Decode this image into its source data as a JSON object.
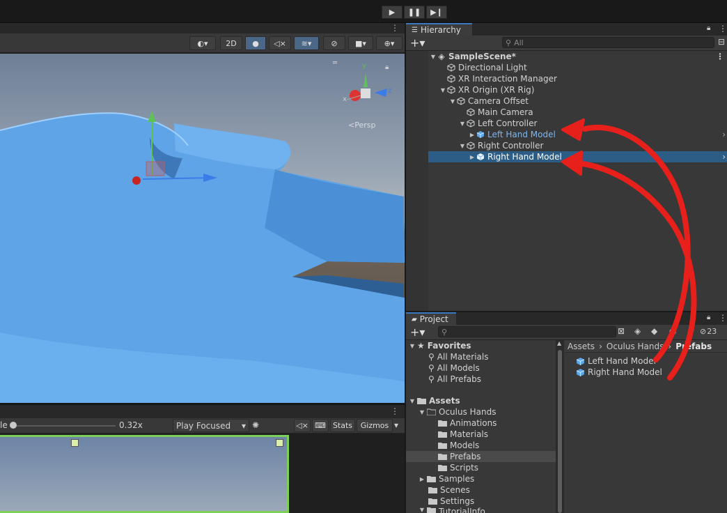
{
  "scene_toolbar": {
    "mode_2d": "2D"
  },
  "scene_view": {
    "axis_y": "y",
    "axis_z": "z",
    "axis_x": "x",
    "projection": "<Persp"
  },
  "game_toolbar": {
    "scale_label": "le",
    "scale_value": "0.32x",
    "play_mode": "Play Focused",
    "stats": "Stats",
    "gizmos": "Gizmos"
  },
  "hierarchy": {
    "tab_title": "Hierarchy",
    "search_placeholder": "All",
    "items": [
      {
        "label": "SampleScene*"
      },
      {
        "label": "Directional Light"
      },
      {
        "label": "XR Interaction Manager"
      },
      {
        "label": "XR Origin (XR Rig)"
      },
      {
        "label": "Camera Offset"
      },
      {
        "label": "Main Camera"
      },
      {
        "label": "Left Controller"
      },
      {
        "label": "Left Hand Model"
      },
      {
        "label": "Right Controller"
      },
      {
        "label": "Right Hand Model"
      }
    ]
  },
  "project": {
    "tab_title": "Project",
    "hidden_count": "23",
    "tree": [
      {
        "label": "Favorites"
      },
      {
        "label": "All Materials"
      },
      {
        "label": "All Models"
      },
      {
        "label": "All Prefabs"
      },
      {
        "label": "Assets"
      },
      {
        "label": "Oculus Hands"
      },
      {
        "label": "Animations"
      },
      {
        "label": "Materials"
      },
      {
        "label": "Models"
      },
      {
        "label": "Prefabs"
      },
      {
        "label": "Scripts"
      },
      {
        "label": "Samples"
      },
      {
        "label": "Scenes"
      },
      {
        "label": "Settings"
      },
      {
        "label": "TutorialInfo"
      }
    ],
    "breadcrumb": [
      "Assets",
      "Oculus Hands",
      "Prefabs"
    ],
    "assets": [
      {
        "label": "Left Hand Model"
      },
      {
        "label": "Right Hand Model"
      }
    ]
  },
  "colors": {
    "selection": "#2c5d87",
    "prefab_blue": "#7fb6ee",
    "annotation_red": "#e8201c",
    "hand_blue": "#5ea4e6"
  }
}
